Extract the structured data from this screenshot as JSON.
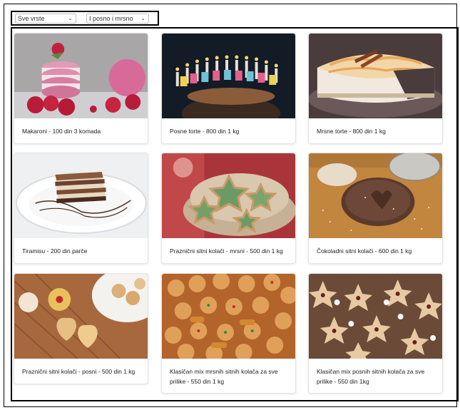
{
  "filters": {
    "category": "Sve vrste",
    "type": "I posno i mrsno"
  },
  "products": [
    {
      "label": "Makaroni - 100 din 3 komada",
      "image": "macarons-photo"
    },
    {
      "label": "Posne torte - 800 din 1 kg",
      "image": "birthday-cake-photo"
    },
    {
      "label": "Mrsne torte - 800 din 1 kg",
      "image": "cheesecake-photo"
    },
    {
      "label": "Tiramisu - 200 din parče",
      "image": "tiramisu-photo"
    },
    {
      "label": "Praznični sitni kolači - mrsni - 500 din 1 kg",
      "image": "star-cookies-photo"
    },
    {
      "label": "Čokoladni sitni kolači - 600 din 1 kg",
      "image": "chocolate-cookie-photo"
    },
    {
      "label": "Praznični sitni kolači - posni - 500 din 1 kg",
      "image": "heart-cookies-photo"
    },
    {
      "label": "Klasičan mix mrsnih sitnih kolača za sve prilike - 550 din 1 kg",
      "image": "mixed-cookies-photo"
    },
    {
      "label": "Klasičan mix posnih sitnih kolača za sve prilike - 550 din 1kg",
      "image": "gingerbread-cookies-photo"
    }
  ]
}
